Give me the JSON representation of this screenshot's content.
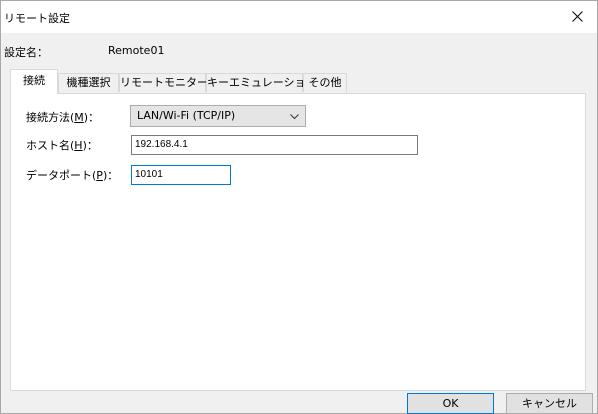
{
  "window": {
    "title": "リモート設定",
    "close_icon": "close-icon"
  },
  "settings_name": {
    "label": "設定名：",
    "value": "Remote01"
  },
  "tabs": [
    {
      "label": "接続",
      "active": true
    },
    {
      "label": "機種選択",
      "active": false
    },
    {
      "label": "リモートモニター",
      "active": false
    },
    {
      "label": "キーエミュレーション",
      "active": false
    },
    {
      "label": "その他",
      "active": false
    }
  ],
  "connection": {
    "method": {
      "label_prefix": "接続方法(",
      "accel": "M",
      "label_suffix": ")：",
      "value": "LAN/Wi-Fi (TCP/IP)",
      "icon": "chevron-down-icon"
    },
    "host": {
      "label_prefix": "ホスト名(",
      "accel": "H",
      "label_suffix": ")：",
      "value": "192.168.4.1"
    },
    "port": {
      "label_prefix": "データポート(",
      "accel": "P",
      "label_suffix": ")：",
      "value": "10101"
    }
  },
  "buttons": {
    "ok": "OK",
    "cancel": "キャンセル"
  }
}
